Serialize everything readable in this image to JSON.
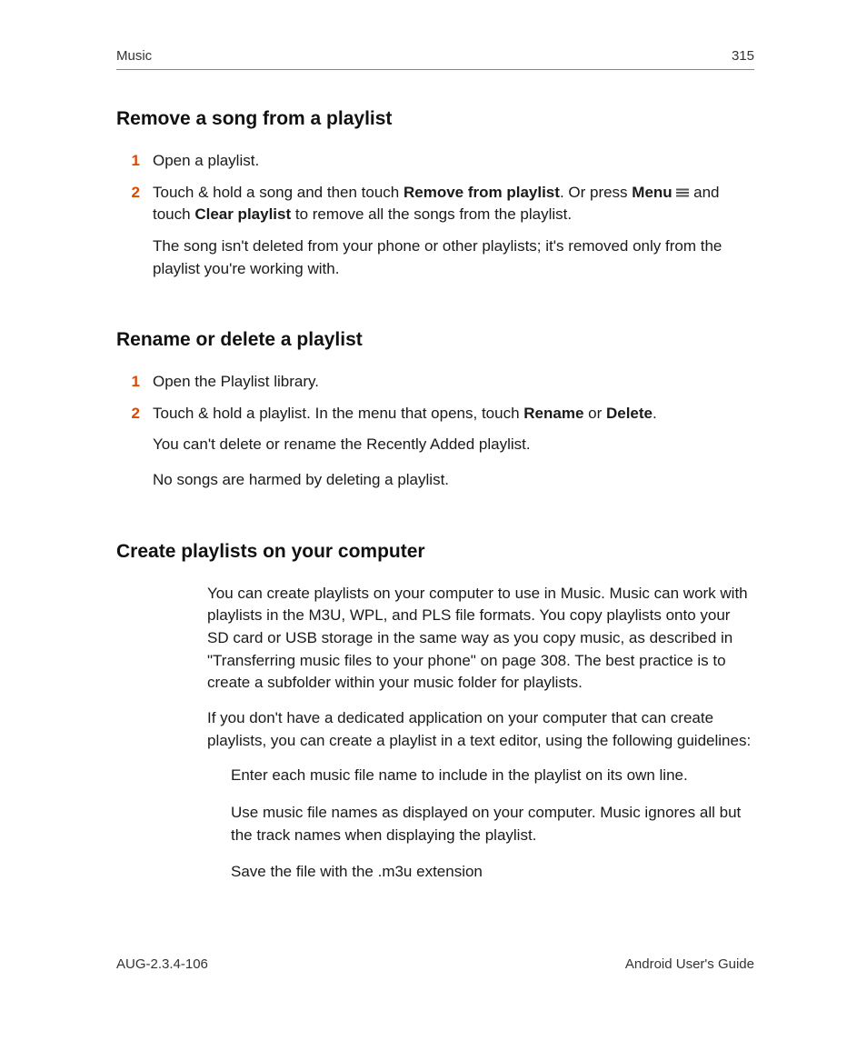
{
  "header": {
    "chapter": "Music",
    "page": "315"
  },
  "sections": [
    {
      "heading": "Remove a song from a playlist",
      "steps": [
        {
          "n": "1",
          "segments": [
            {
              "t": "Open a playlist."
            }
          ]
        },
        {
          "n": "2",
          "segments": [
            {
              "t": "Touch & hold a song and then touch "
            },
            {
              "t": "Remove from playlist",
              "bold": true
            },
            {
              "t": ". Or press "
            },
            {
              "t": "Menu",
              "bold": true
            },
            {
              "t": " "
            },
            {
              "icon": "menu"
            },
            {
              "t": " and touch "
            },
            {
              "t": "Clear playlist",
              "bold": true
            },
            {
              "t": " to remove all the songs from the playlist."
            }
          ],
          "note": "The song isn't deleted from your phone or other playlists; it's removed only from the playlist you're working with."
        }
      ]
    },
    {
      "heading": "Rename or delete a playlist",
      "steps": [
        {
          "n": "1",
          "segments": [
            {
              "t": "Open the Playlist library."
            }
          ]
        },
        {
          "n": "2",
          "segments": [
            {
              "t": "Touch & hold a playlist. In the menu that opens, touch "
            },
            {
              "t": "Rename",
              "bold": true
            },
            {
              "t": " or "
            },
            {
              "t": "Delete",
              "bold": true
            },
            {
              "t": "."
            }
          ],
          "note": "You can't delete or rename the Recently Added playlist.",
          "note2": "No songs are harmed by deleting a playlist."
        }
      ]
    },
    {
      "heading": "Create playlists on your computer",
      "paras": [
        "You can create playlists on your computer to use in Music. Music can work with playlists in the M3U, WPL, and PLS file formats. You copy playlists onto your SD card or USB storage in the same way as you copy music, as described in \"Transferring music files to your phone\" on page 308. The best practice is to create a subfolder within your music folder for playlists.",
        "If you don't have a dedicated application on your computer that can create playlists, you can create a playlist in a text editor, using the following guidelines:"
      ],
      "bullets": [
        "Enter each music file name to include in the playlist on its own line.",
        "Use music file names as displayed on your computer. Music ignores all but the track names when displaying the playlist.",
        "Save the file with the .m3u extension"
      ]
    }
  ],
  "footer": {
    "doc_id": "AUG-2.3.4-106",
    "title": "Android User's Guide"
  }
}
